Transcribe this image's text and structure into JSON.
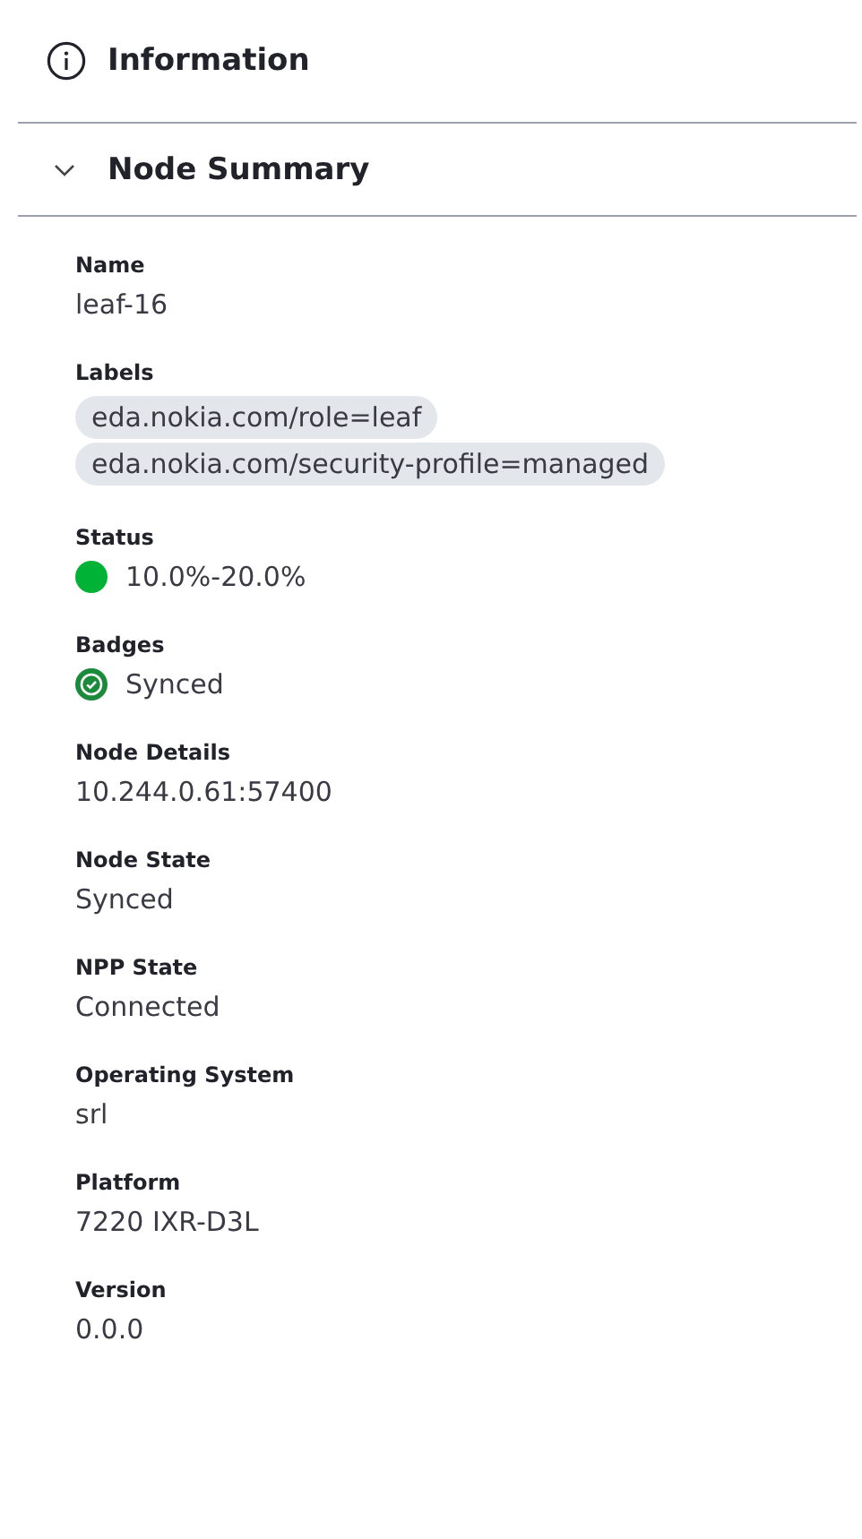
{
  "panel": {
    "title": "Information"
  },
  "section": {
    "title": "Node Summary",
    "expanded": true
  },
  "fields": [
    {
      "kind": "text",
      "label": "Name",
      "value": "leaf-16"
    },
    {
      "kind": "chips",
      "label": "Labels",
      "chips": [
        "eda.nokia.com/role=leaf",
        "eda.nokia.com/security-profile=managed"
      ]
    },
    {
      "kind": "status",
      "label": "Status",
      "value": "10.0%-20.0%",
      "color": "#00b336"
    },
    {
      "kind": "badge",
      "label": "Badges",
      "value": "Synced"
    },
    {
      "kind": "text",
      "label": "Node Details",
      "value": "10.244.0.61:57400"
    },
    {
      "kind": "text",
      "label": "Node State",
      "value": "Synced"
    },
    {
      "kind": "text",
      "label": "NPP State",
      "value": "Connected"
    },
    {
      "kind": "text",
      "label": "Operating System",
      "value": "srl"
    },
    {
      "kind": "text",
      "label": "Platform",
      "value": "7220 IXR-D3L"
    },
    {
      "kind": "text",
      "label": "Version",
      "value": "0.0.0"
    }
  ]
}
